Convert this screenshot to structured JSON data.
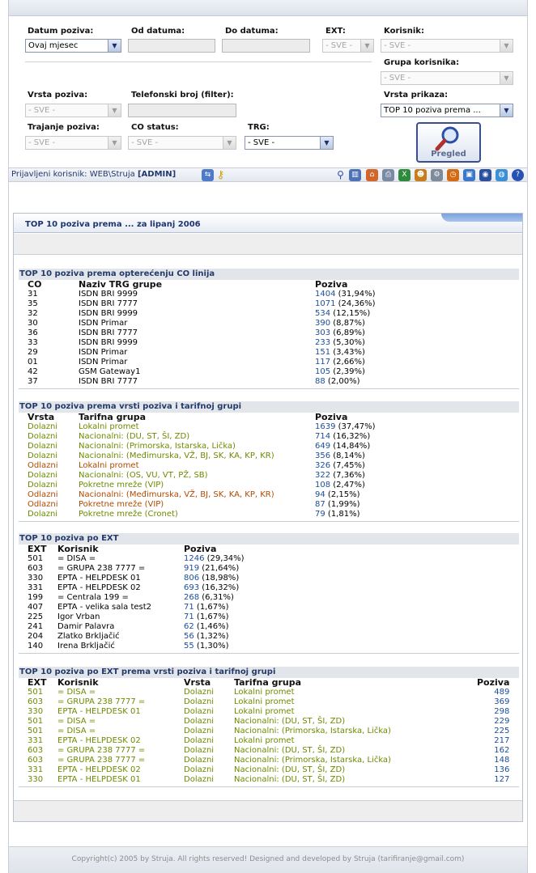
{
  "filters": {
    "datum_poziva": {
      "label": "Datum poziva:",
      "value": "Ovaj mjesec"
    },
    "od_datuma": {
      "label": "Od datuma:",
      "value": ""
    },
    "do_datuma": {
      "label": "Do datuma:",
      "value": ""
    },
    "ext": {
      "label": "EXT:",
      "value": "- SVE -"
    },
    "korisnik": {
      "label": "Korisnik:",
      "value": "- SVE -"
    },
    "grupa_korisnika": {
      "label": "Grupa korisnika:",
      "value": "- SVE -"
    },
    "vrsta_poziva": {
      "label": "Vrsta poziva:",
      "value": "- SVE -"
    },
    "telefonski_broj": {
      "label": "Telefonski broj (filter):",
      "value": ""
    },
    "vrsta_prikaza": {
      "label": "Vrsta prikaza:",
      "value": "TOP 10 poziva prema ..."
    },
    "trajanje_poziva": {
      "label": "Trajanje poziva:",
      "value": "- SVE -"
    },
    "co_status": {
      "label": "CO status:",
      "value": "- SVE -"
    },
    "trg": {
      "label": "TRG:",
      "value": "- SVE -"
    },
    "pregled_button": "Pregled"
  },
  "userbar": {
    "prefix": "Prijavljeni korisnik:",
    "user": "WEB\\Struja",
    "role": "[ADMIN]",
    "icons": [
      "users-icon",
      "key-icon",
      "search-icon",
      "book-icon",
      "home-icon",
      "printer-icon",
      "excel-icon",
      "group-icon",
      "settings-icon",
      "clock-icon",
      "window-icon",
      "disk-icon",
      "globe-icon",
      "help-icon"
    ]
  },
  "report": {
    "title": "TOP 10 poziva prema ... za lipanj 2006",
    "sections": [
      {
        "title": "TOP 10 poziva prema opterećenju CO linija",
        "columns": [
          "CO",
          "Naziv TRG grupe",
          "Poziva"
        ],
        "rows": [
          [
            "31",
            "ISDN BRI 9999",
            "1404",
            "(31,94%)"
          ],
          [
            "35",
            "ISDN BRI 7777",
            "1071",
            "(24,36%)"
          ],
          [
            "32",
            "ISDN BRI 9999",
            "534",
            "(12,15%)"
          ],
          [
            "30",
            "ISDN Primar",
            "390",
            "(8,87%)"
          ],
          [
            "36",
            "ISDN BRI 7777",
            "303",
            "(6,89%)"
          ],
          [
            "33",
            "ISDN BRI 9999",
            "233",
            "(5,30%)"
          ],
          [
            "29",
            "ISDN Primar",
            "151",
            "(3,43%)"
          ],
          [
            "01",
            "ISDN Primar",
            "117",
            "(2,66%)"
          ],
          [
            "42",
            "GSM Gateway1",
            "105",
            "(2,39%)"
          ],
          [
            "37",
            "ISDN BRI 7777",
            "88",
            "(2,00%)"
          ]
        ]
      },
      {
        "title": "TOP 10 poziva prema vrsti poziva i tarifnoj grupi",
        "columns": [
          "Vrsta",
          "Tarifna grupa",
          "Poziva"
        ],
        "rows": [
          [
            "Dolazni",
            "Lokalni promet",
            "1639",
            "(37,47%)"
          ],
          [
            "Dolazni",
            "Nacionalni: (DU, ST, ŠI, ZD)",
            "714",
            "(16,32%)"
          ],
          [
            "Dolazni",
            "Nacionalni: (Primorska, Istarska, Lička)",
            "649",
            "(14,84%)"
          ],
          [
            "Dolazni",
            "Nacionalni: (Međimurska, VŽ, BJ, SK, KA, KP, KR)",
            "356",
            "(8,14%)"
          ],
          [
            "Odlazni",
            "Lokalni promet",
            "326",
            "(7,45%)"
          ],
          [
            "Dolazni",
            "Nacionalni: (OS, VU, VT, PŽ, SB)",
            "322",
            "(7,36%)"
          ],
          [
            "Dolazni",
            "Pokretne mreže (VIP)",
            "108",
            "(2,47%)"
          ],
          [
            "Odlazni",
            "Nacionalni: (Međimurska, VŽ, BJ, SK, KA, KP, KR)",
            "94",
            "(2,15%)"
          ],
          [
            "Odlazni",
            "Pokretne mreže (VIP)",
            "87",
            "(1,99%)"
          ],
          [
            "Dolazni",
            "Pokretne mreže (Cronet)",
            "79",
            "(1,81%)"
          ]
        ]
      },
      {
        "title": "TOP 10 poziva po EXT",
        "columns": [
          "EXT",
          "Korisnik",
          "Poziva"
        ],
        "rows": [
          [
            "501",
            "= DISA =",
            "1246",
            "(29,34%)"
          ],
          [
            "603",
            "= GRUPA 238 7777 =",
            "919",
            "(21,64%)"
          ],
          [
            "330",
            "EPTA - HELPDESK 01",
            "806",
            "(18,98%)"
          ],
          [
            "331",
            "EPTA - HELPDESK 02",
            "693",
            "(16,32%)"
          ],
          [
            "199",
            "= Centrala 199 =",
            "268",
            "(6,31%)"
          ],
          [
            "407",
            "EPTA - velika sala test2",
            "71",
            "(1,67%)"
          ],
          [
            "225",
            "Igor Vrban",
            "71",
            "(1,67%)"
          ],
          [
            "241",
            "Damir Palavra",
            "62",
            "(1,46%)"
          ],
          [
            "204",
            "Zlatko Brkljačić",
            "56",
            "(1,32%)"
          ],
          [
            "140",
            "Irena Brkljačić",
            "55",
            "(1,30%)"
          ]
        ]
      },
      {
        "title": "TOP 10 poziva po EXT prema vrsti poziva i tarifnoj grupi",
        "columns": [
          "EXT",
          "Korisnik",
          "Vrsta",
          "Tarifna grupa",
          "Poziva"
        ],
        "rows": [
          [
            "501",
            "= DISA =",
            "Dolazni",
            "Lokalni promet",
            "489"
          ],
          [
            "603",
            "= GRUPA 238 7777 =",
            "Dolazni",
            "Lokalni promet",
            "369"
          ],
          [
            "330",
            "EPTA - HELPDESK 01",
            "Dolazni",
            "Lokalni promet",
            "298"
          ],
          [
            "501",
            "= DISA =",
            "Dolazni",
            "Nacionalni: (DU, ST, ŠI, ZD)",
            "229"
          ],
          [
            "501",
            "= DISA =",
            "Dolazni",
            "Nacionalni: (Primorska, Istarska, Lička)",
            "225"
          ],
          [
            "331",
            "EPTA - HELPDESK 02",
            "Dolazni",
            "Lokalni promet",
            "217"
          ],
          [
            "603",
            "= GRUPA 238 7777 =",
            "Dolazni",
            "Nacionalni: (DU, ST, ŠI, ZD)",
            "162"
          ],
          [
            "603",
            "= GRUPA 238 7777 =",
            "Dolazni",
            "Nacionalni: (Primorska, Istarska, Lička)",
            "148"
          ],
          [
            "331",
            "EPTA - HELPDESK 02",
            "Dolazni",
            "Nacionalni: (DU, ST, ŠI, ZD)",
            "136"
          ],
          [
            "330",
            "EPTA - HELPDESK 01",
            "Dolazni",
            "Nacionalni: (DU, ST, ŠI, ZD)",
            "127"
          ]
        ]
      }
    ]
  },
  "footer": "Copyright(c) 2005 by Struja. All rights reserved! Designed and developed by Struja (tarifiranje@gmail.com)",
  "colors": {
    "accent": "#1d3470",
    "number": "#1a4e9a",
    "incoming": "#6c8a00",
    "outgoing": "#b04a00"
  }
}
